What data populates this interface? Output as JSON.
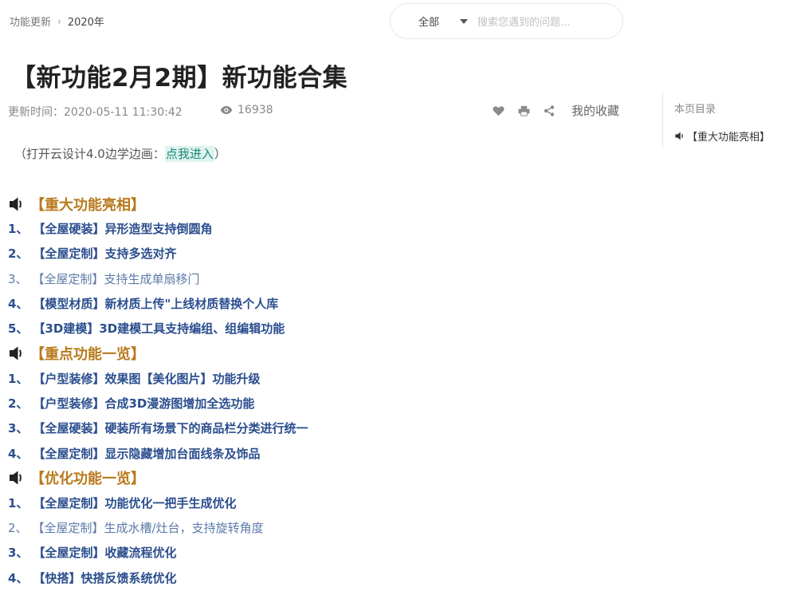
{
  "breadcrumb": {
    "parent": "功能更新",
    "separator": "›",
    "current": "2020年"
  },
  "search": {
    "scope": "全部",
    "placeholder": "搜索您遇到的问题..."
  },
  "article": {
    "title": "【新功能2月2期】新功能合集",
    "updated": "更新时间：2020-05-11 11:30:42",
    "views": "16938",
    "favorite_label": "我的收藏"
  },
  "toc": {
    "title": "本页目录",
    "items": [
      "【重大功能亮相】"
    ]
  },
  "intro": {
    "prefix": "（打开云设计4.0边学边画：",
    "link": "点我进入",
    "suffix": "）"
  },
  "sections": [
    {
      "title": "【重大功能亮相】",
      "items": [
        {
          "num": "1、",
          "text": "【全屋硬装】异形造型支持倒圆角"
        },
        {
          "num": "2、",
          "text": "【全屋定制】支持多选对齐"
        },
        {
          "num": "3、",
          "text": "【全屋定制】支持生成单扇移门"
        },
        {
          "num": "4、",
          "text": "【模型材质】新材质上传\"上线材质替换个人库"
        },
        {
          "num": "5、",
          "text": "【3D建模】3D建模工具支持编组、组编辑功能"
        }
      ]
    },
    {
      "title": "【重点功能一览】",
      "items": [
        {
          "num": "1、",
          "text": "【户型装修】效果图【美化图片】功能升级"
        },
        {
          "num": "2、",
          "text": "【户型装修】合成3D漫游图增加全选功能"
        },
        {
          "num": "3、",
          "text": "【全屋硬装】硬装所有场景下的商品栏分类进行统一"
        },
        {
          "num": "4、",
          "text": "【全屋定制】显示隐藏增加台面线条及饰品"
        }
      ]
    },
    {
      "title": "【优化功能一览】",
      "items": [
        {
          "num": "1、",
          "text": "【全屋定制】功能优化一把手生成优化"
        },
        {
          "num": "2、",
          "text": "【全屋定制】生成水槽/灶台，支持旋转角度"
        },
        {
          "num": "3、",
          "text": "【全屋定制】收藏流程优化"
        },
        {
          "num": "4、",
          "text": "【快搭】快搭反馈系统优化"
        }
      ]
    }
  ]
}
